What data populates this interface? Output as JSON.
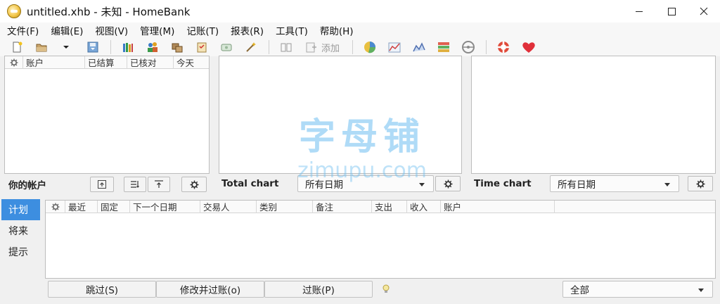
{
  "window": {
    "title": "untitled.xhb - 未知 - HomeBank",
    "minimize_icon": "minimize-icon",
    "maximize_icon": "maximize-icon",
    "close_icon": "close-icon"
  },
  "menu": [
    "文件(F)",
    "编辑(E)",
    "视图(V)",
    "管理(M)",
    "记账(T)",
    "报表(R)",
    "工具(T)",
    "帮助(H)"
  ],
  "toolbar": {
    "add_label": "添加"
  },
  "accounts": {
    "headers": [
      "账户",
      "已结算",
      "已核对",
      "今天"
    ],
    "footer_title": "你的帐户"
  },
  "total_chart": {
    "title": "Total chart",
    "range_value": "所有日期"
  },
  "time_chart": {
    "title": "Time chart",
    "range_value": "所有日期"
  },
  "side_tabs": [
    "计划",
    "将来",
    "提示"
  ],
  "scheduled": {
    "headers": [
      "最近",
      "固定",
      "下一个日期",
      "交易人",
      "类别",
      "备注",
      "支出",
      "收入",
      "账户"
    ],
    "skip_label": "跳过(S)",
    "edit_post_label": "修改并过账(o)",
    "post_label": "过账(P)",
    "filter_value": "全部"
  },
  "watermark": {
    "cn": "字母铺",
    "en": "zimupu.com"
  },
  "colors": {
    "accent": "#3d8ee0",
    "watermark": "#6ebef0"
  }
}
